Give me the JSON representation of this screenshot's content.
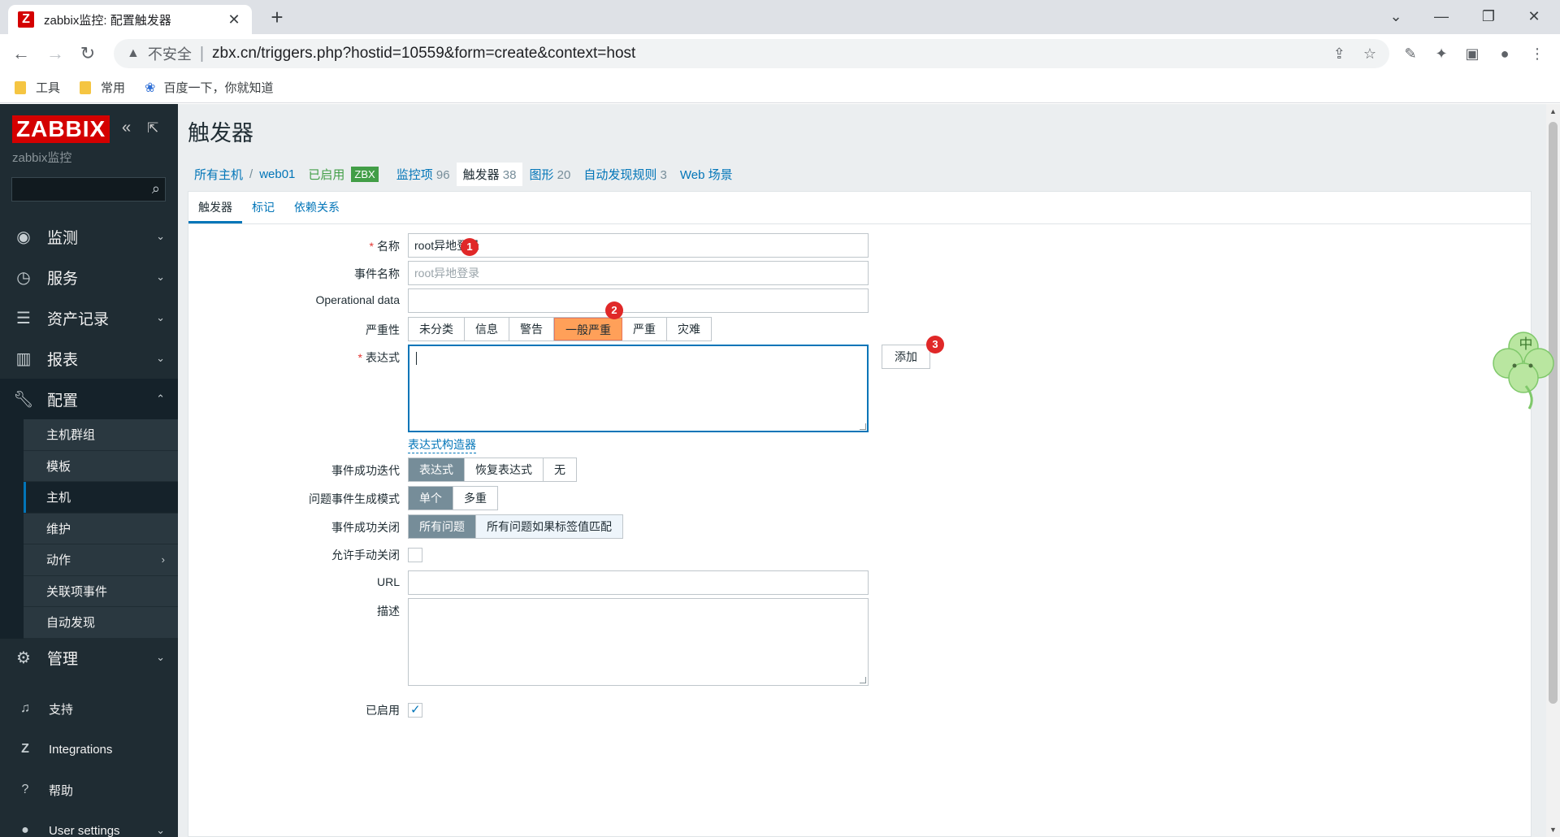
{
  "browser": {
    "tab_title": "zabbix监控: 配置触发器",
    "tab_favicon": "Z",
    "new_tab": "+",
    "minimize": "—",
    "maximize": "❐",
    "close": "✕",
    "tab_list": "⌄",
    "security_label": "不安全",
    "url": "zbx.cn/triggers.php?hostid=10559&form=create&context=host",
    "bookmarks": [
      "工具",
      "常用",
      "百度一下，你就知道"
    ]
  },
  "sidebar": {
    "logo": "ZABBIX",
    "server_name": "zabbix监控",
    "search_placeholder": "",
    "menu": [
      {
        "label": "监测",
        "icon": "eye-icon"
      },
      {
        "label": "服务",
        "icon": "clock-icon"
      },
      {
        "label": "资产记录",
        "icon": "list-icon"
      },
      {
        "label": "报表",
        "icon": "chart-icon"
      },
      {
        "label": "配置",
        "icon": "wrench-icon"
      },
      {
        "label": "管理",
        "icon": "gear-icon"
      }
    ],
    "submenu": [
      "主机群组",
      "模板",
      "主机",
      "维护",
      "动作",
      "关联项事件",
      "自动发现"
    ],
    "bottom": [
      {
        "label": "支持",
        "icon": "headset-icon"
      },
      {
        "label": "Integrations",
        "icon": "zabbix-icon"
      },
      {
        "label": "帮助",
        "icon": "help-icon"
      },
      {
        "label": "User settings",
        "icon": "user-icon"
      }
    ]
  },
  "page": {
    "title": "触发器",
    "breadcrumbs": {
      "all_hosts": "所有主机",
      "sep": "/",
      "host": "web01",
      "status": "已启用",
      "zbx_badge": "ZBX",
      "items": "监控项",
      "items_count": "96",
      "triggers": "触发器",
      "triggers_count": "38",
      "graphs": "图形",
      "graphs_count": "20",
      "discovery": "自动发现规则",
      "discovery_count": "3",
      "web": "Web 场景"
    },
    "subtabs": [
      "触发器",
      "标记",
      "依赖关系"
    ]
  },
  "form": {
    "name_label": "名称",
    "name_value": "root异地登录",
    "event_name_label": "事件名称",
    "event_name_placeholder": "root异地登录",
    "opdata_label": "Operational data",
    "opdata_value": "",
    "severity_label": "严重性",
    "severity_options": [
      "未分类",
      "信息",
      "警告",
      "一般严重",
      "严重",
      "灾难"
    ],
    "severity_selected": "一般严重",
    "expression_label": "表达式",
    "add_button": "添加",
    "expression_builder": "表达式构造器",
    "ok_event_gen_label": "事件成功迭代",
    "ok_event_gen_options": [
      "表达式",
      "恢复表达式",
      "无"
    ],
    "problem_mode_label": "问题事件生成模式",
    "problem_mode_options": [
      "单个",
      "多重"
    ],
    "ok_close_label": "事件成功关闭",
    "ok_close_options": [
      "所有问题",
      "所有问题如果标签值匹配"
    ],
    "manual_close_label": "允许手动关闭",
    "url_label": "URL",
    "desc_label": "描述",
    "enabled_label": "已启用",
    "required_mark": "*"
  },
  "markers": [
    "1",
    "2",
    "3"
  ],
  "colors": {
    "sidebar_bg": "#1f2c33",
    "accent": "#0275b8",
    "logo_red": "#d40000",
    "severity_average": "#ffa059",
    "enabled_green": "#429e47",
    "marker_red": "#e02828"
  }
}
